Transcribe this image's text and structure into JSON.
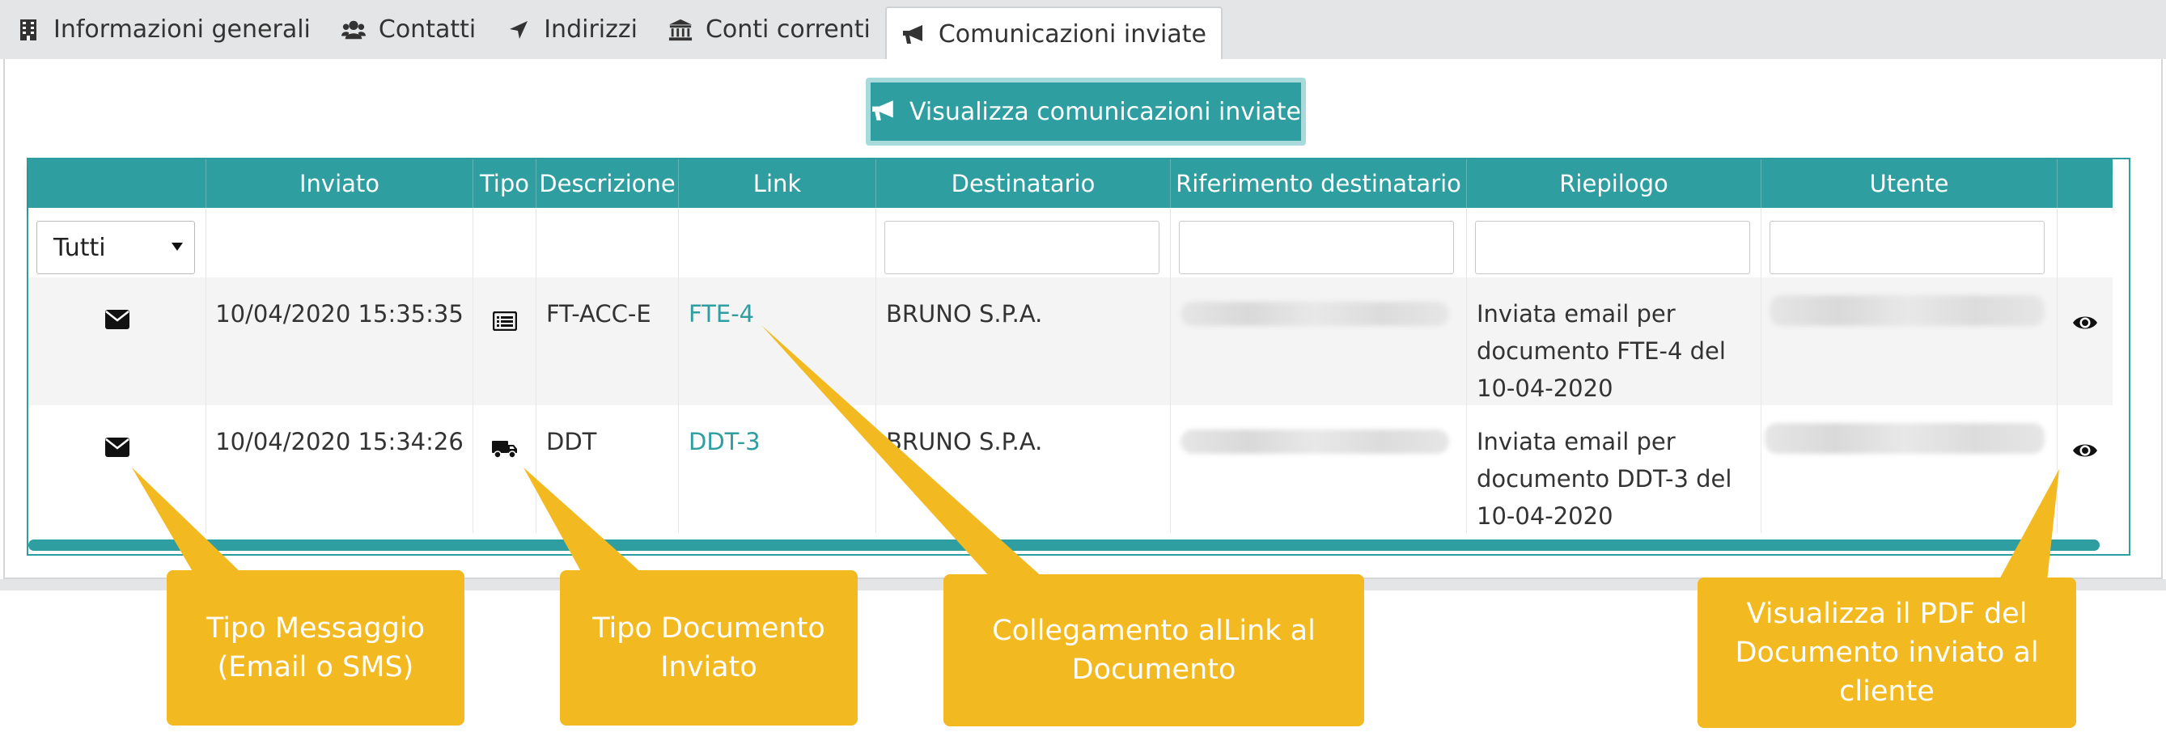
{
  "tabs": [
    {
      "label": "Informazioni generali",
      "icon": "building-icon",
      "active": false
    },
    {
      "label": "Contatti",
      "icon": "users-icon",
      "active": false
    },
    {
      "label": "Indirizzi",
      "icon": "location-arrow-icon",
      "active": false
    },
    {
      "label": "Conti correnti",
      "icon": "bank-icon",
      "active": false
    },
    {
      "label": "Comunicazioni inviate",
      "icon": "bullhorn-icon",
      "active": true
    }
  ],
  "main_button": {
    "label": "Visualizza comunicazioni inviate",
    "icon": "bullhorn-icon"
  },
  "table": {
    "columns": [
      "",
      "Inviato",
      "Tipo",
      "Descrizione",
      "Link",
      "Destinatario",
      "Riferimento destinatario",
      "Riepilogo",
      "Utente",
      ""
    ],
    "filter": {
      "select_value": "Tutti"
    },
    "rows": [
      {
        "message_type_icon": "envelope-icon",
        "inviato": "10/04/2020 15:35:35",
        "tipo_icon": "list-alt-icon",
        "descrizione": "FT-ACC-E",
        "link": "FTE-4",
        "destinatario": "BRUNO S.P.A.",
        "riepilogo_lines": [
          "Inviata email per",
          "documento FTE-4 del",
          "10-04-2020"
        ],
        "view_icon": "eye-icon"
      },
      {
        "message_type_icon": "envelope-icon",
        "inviato": "10/04/2020 15:34:26",
        "tipo_icon": "truck-icon",
        "descrizione": "DDT",
        "link": "DDT-3",
        "destinatario": "BRUNO S.P.A.",
        "riepilogo_lines": [
          "Inviata email per",
          "documento DDT-3 del",
          "10-04-2020"
        ],
        "view_icon": "eye-icon"
      }
    ]
  },
  "callouts": [
    {
      "lines": [
        "Tipo Messaggio",
        "(Email o SMS)"
      ]
    },
    {
      "lines": [
        "Tipo Documento",
        "Inviato"
      ]
    },
    {
      "lines": [
        "Collegamento alLink al",
        "Documento"
      ]
    },
    {
      "lines": [
        "Visualizza il PDF del",
        "Documento inviato al",
        "cliente"
      ]
    }
  ],
  "colors": {
    "accent": "#2f9ea0",
    "callout": "#f2b920",
    "link": "#2f9ea0"
  }
}
